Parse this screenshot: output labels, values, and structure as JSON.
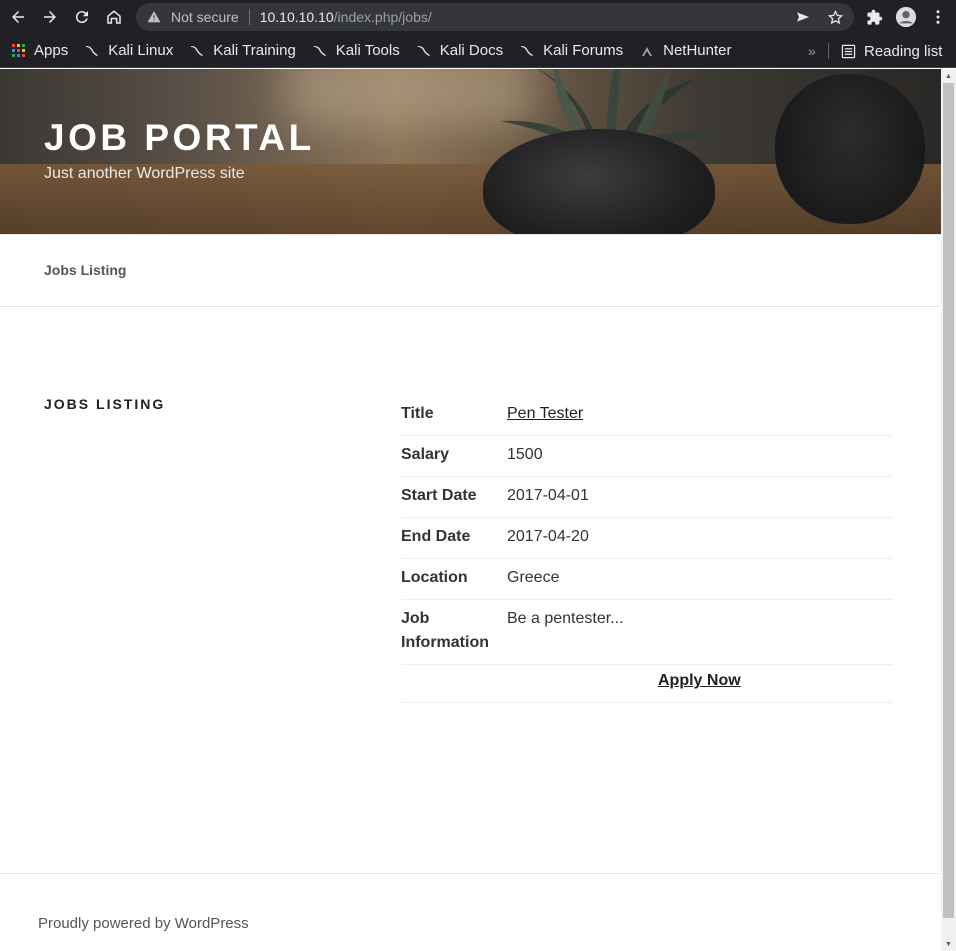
{
  "browser": {
    "security_label": "Not secure",
    "url_host": "10.10.10.10",
    "url_path": "/index.php/jobs/",
    "bookmarks": [
      {
        "label": "Apps",
        "icon": "apps-grid-icon"
      },
      {
        "label": "Kali Linux",
        "icon": "kali-dragon-icon"
      },
      {
        "label": "Kali Training",
        "icon": "kali-dragon-icon"
      },
      {
        "label": "Kali Tools",
        "icon": "kali-dragon-icon"
      },
      {
        "label": "Kali Docs",
        "icon": "kali-dragon-icon"
      },
      {
        "label": "Kali Forums",
        "icon": "kali-dragon-icon"
      },
      {
        "label": "NetHunter",
        "icon": "nethunter-icon"
      }
    ],
    "more_bookmarks": "»",
    "reading_list": "Reading list"
  },
  "site": {
    "title": "JOB PORTAL",
    "description": "Just another WordPress site"
  },
  "menu": {
    "items": [
      "Jobs Listing"
    ]
  },
  "page": {
    "title": "JOBS LISTING"
  },
  "job": {
    "rows": [
      {
        "label": "Title",
        "value": "Pen Tester",
        "link": true
      },
      {
        "label": "Salary",
        "value": "1500"
      },
      {
        "label": "Start Date",
        "value": "2017-04-01"
      },
      {
        "label": "End Date",
        "value": "2017-04-20"
      },
      {
        "label": "Location",
        "value": "Greece"
      },
      {
        "label": "Job Information",
        "value": "Be a pentester..."
      }
    ],
    "apply_label": "Apply Now"
  },
  "footer": {
    "powered_by": "Proudly powered by WordPress"
  },
  "colors": {
    "chrome_bg": "#202124",
    "omnibox_bg": "#35363a",
    "text_dark": "#222222"
  }
}
